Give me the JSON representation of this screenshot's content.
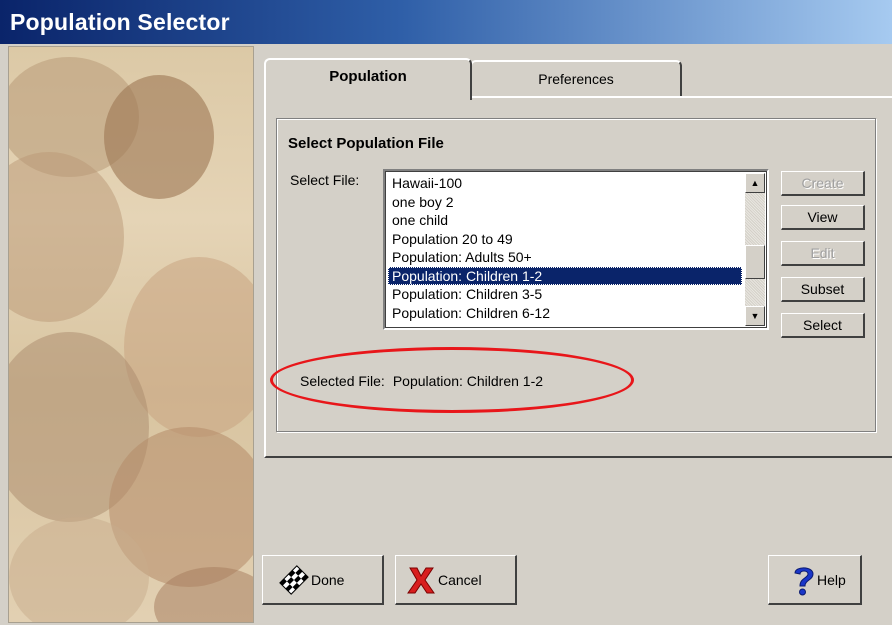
{
  "window": {
    "title": "Population Selector"
  },
  "tabs": [
    {
      "label": "Population",
      "active": true
    },
    {
      "label": "Preferences",
      "active": false
    }
  ],
  "group": {
    "title": "Select Population File",
    "select_label": "Select File:"
  },
  "file_list": {
    "items": [
      "Hawaii-100",
      "one boy 2",
      "one child",
      "Population 20 to 49",
      "Population: Adults 50+",
      "Population: Children 1-2",
      "Population: Children 3-5",
      "Population: Children 6-12"
    ],
    "selected": "Population: Children 1-2"
  },
  "side_buttons": {
    "create": "Create",
    "view": "View",
    "edit": "Edit",
    "subset": "Subset",
    "select": "Select"
  },
  "selected_file": {
    "label": "Selected File:",
    "value": "Population: Children 1-2"
  },
  "bottom_buttons": {
    "done": "Done",
    "cancel": "Cancel",
    "help": "Help"
  },
  "colors": {
    "selection": "#0a246a",
    "highlight_ellipse": "#e8161a",
    "dialog_face": "#d4d0c8"
  },
  "icons": {
    "done": "checkered-flag-icon",
    "cancel": "red-x-icon",
    "help": "blue-question-mark-icon"
  }
}
